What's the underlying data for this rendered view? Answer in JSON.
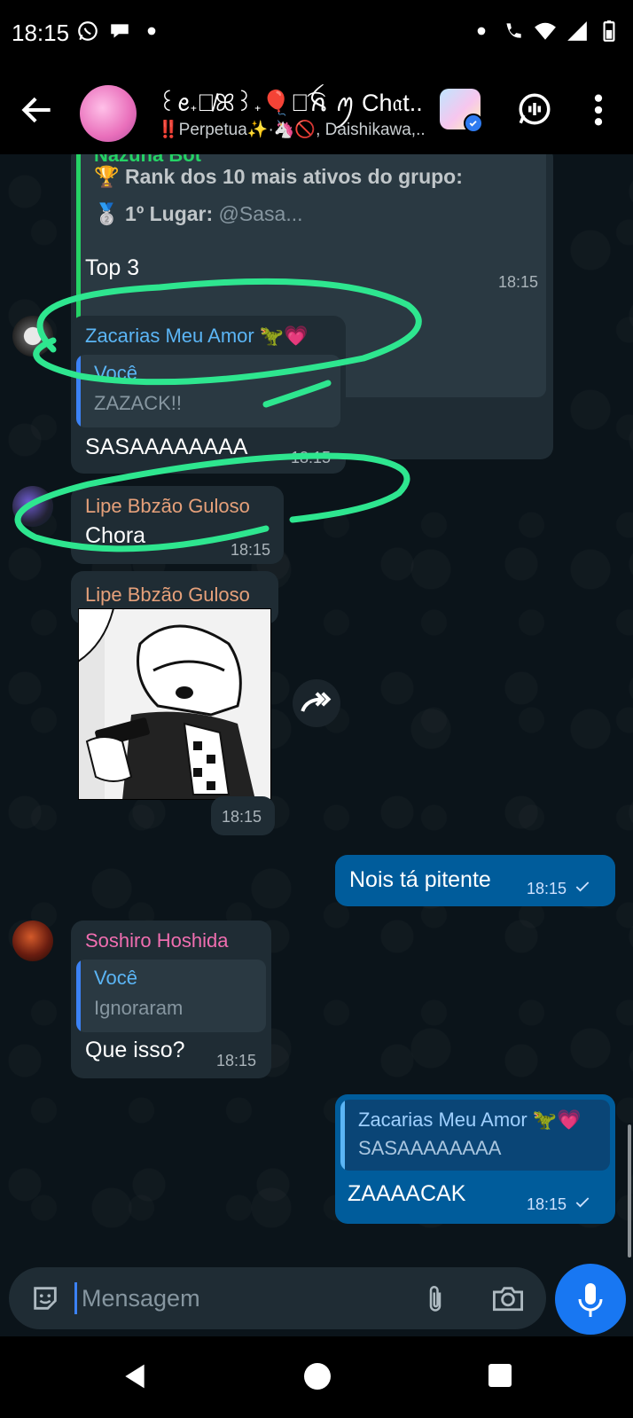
{
  "status_bar": {
    "time": "18:15",
    "icons_left": [
      "whatsapp-icon",
      "chat-bubble-icon",
      "dot-icon"
    ],
    "icons_right": [
      "dot-icon",
      "wifi-call-icon",
      "wifi-icon",
      "signal-icon",
      "battery-icon"
    ]
  },
  "header": {
    "title": "꒰ꫀ𝅄ᰔ̸ꕤ꒱𝅄🎈ꪆ͡ꫝ ꪑ Ch𝔞t...",
    "subtitle_prefix": "‼️",
    "subtitle_name": "Perpetua✨·🦄🚫",
    "subtitle_rest": ", Daishikawa,..."
  },
  "messages": {
    "m1": {
      "sender": "Nazuna Bot",
      "line1": "🏆 Rank dos 10 mais ativos do grupo:",
      "line2_label": "🥈 1º Lugar:",
      "line2_value": " @Sasa...",
      "text": "Top 3",
      "time": "18:15"
    },
    "m2": {
      "sender": "Zacarias Meu Amor 🦖💗",
      "quote_title": "Você",
      "quote_text": "ZAZACK!!",
      "text": "SASAAAAAAAA",
      "time": "18:15"
    },
    "m3": {
      "sender": "Lipe Bbzão Guloso",
      "text": "Chora",
      "time": "18:15"
    },
    "m4": {
      "sender": "Lipe Bbzão Guloso",
      "time": "18:15"
    },
    "m5": {
      "text": "Nois tá pitente",
      "time": "18:15"
    },
    "m6": {
      "sender": "Soshiro Hoshida",
      "quote_title": "Você",
      "quote_text": "Ignoraram",
      "text": "Que isso?",
      "time": "18:15"
    },
    "m7": {
      "quote_title": "Zacarias Meu Amor 🦖💗",
      "quote_text": "SASAAAAAAAA",
      "text": "ZAAAACAK",
      "time": "18:15"
    }
  },
  "input": {
    "placeholder": "Mensagem"
  },
  "colors": {
    "chat_bg": "#0b141a",
    "incoming": "#1f2c34",
    "outgoing": "#005c9b",
    "accent": "#1877f2",
    "annotation": "#2ee68f"
  }
}
